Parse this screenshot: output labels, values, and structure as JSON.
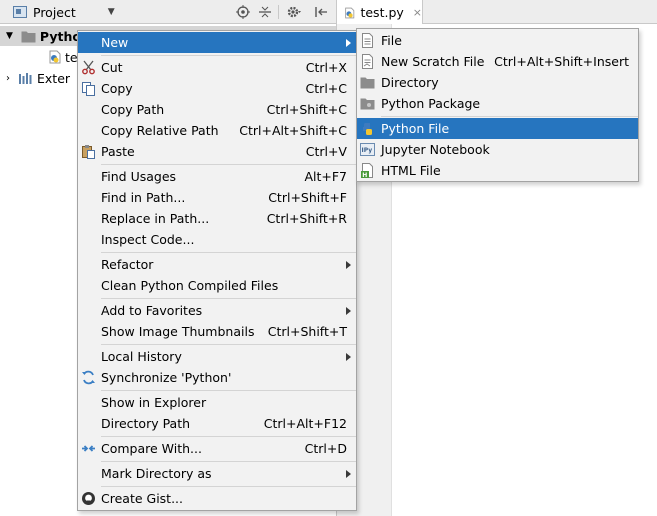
{
  "project_header": {
    "title": "Project"
  },
  "tree": {
    "root_label": "Pytho",
    "file_label": "te",
    "external_label": "Exter"
  },
  "editor": {
    "tab_label": "test.py"
  },
  "context_menu": {
    "items": [
      {
        "label": "New",
        "shortcut": "",
        "submenu": true,
        "icon": "none"
      },
      {
        "label": "Cut",
        "shortcut": "Ctrl+X",
        "icon": "scissors-icon"
      },
      {
        "label": "Copy",
        "shortcut": "Ctrl+C",
        "icon": "copy-icon"
      },
      {
        "label": "Copy Path",
        "shortcut": "Ctrl+Shift+C",
        "icon": "none"
      },
      {
        "label": "Copy Relative Path",
        "shortcut": "Ctrl+Alt+Shift+C",
        "icon": "none"
      },
      {
        "label": "Paste",
        "shortcut": "Ctrl+V",
        "icon": "paste-icon"
      },
      {
        "label": "Find Usages",
        "shortcut": "Alt+F7",
        "icon": "none"
      },
      {
        "label": "Find in Path...",
        "shortcut": "Ctrl+Shift+F",
        "icon": "none"
      },
      {
        "label": "Replace in Path...",
        "shortcut": "Ctrl+Shift+R",
        "icon": "none"
      },
      {
        "label": "Inspect Code...",
        "shortcut": "",
        "icon": "none"
      },
      {
        "label": "Refactor",
        "shortcut": "",
        "submenu": true,
        "icon": "none"
      },
      {
        "label": "Clean Python Compiled Files",
        "shortcut": "",
        "icon": "none"
      },
      {
        "label": "Add to Favorites",
        "shortcut": "",
        "submenu": true,
        "icon": "none"
      },
      {
        "label": "Show Image Thumbnails",
        "shortcut": "Ctrl+Shift+T",
        "icon": "none"
      },
      {
        "label": "Local History",
        "shortcut": "",
        "submenu": true,
        "icon": "none"
      },
      {
        "label": "Synchronize 'Python'",
        "shortcut": "",
        "icon": "sync-icon"
      },
      {
        "label": "Show in Explorer",
        "shortcut": "",
        "icon": "none"
      },
      {
        "label": "Directory Path",
        "shortcut": "Ctrl+Alt+F12",
        "icon": "none"
      },
      {
        "label": "Compare With...",
        "shortcut": "Ctrl+D",
        "icon": "compare-icon"
      },
      {
        "label": "Mark Directory as",
        "shortcut": "",
        "submenu": true,
        "icon": "none"
      },
      {
        "label": "Create Gist...",
        "shortcut": "",
        "icon": "github-icon"
      }
    ]
  },
  "new_submenu": {
    "items": [
      {
        "label": "File",
        "shortcut": "",
        "icon": "file-icon"
      },
      {
        "label": "New Scratch File",
        "shortcut": "Ctrl+Alt+Shift+Insert",
        "icon": "scratch-file-icon"
      },
      {
        "label": "Directory",
        "shortcut": "",
        "icon": "folder-icon"
      },
      {
        "label": "Python Package",
        "shortcut": "",
        "icon": "package-icon"
      },
      {
        "label": "Python File",
        "shortcut": "",
        "icon": "python-icon"
      },
      {
        "label": "Jupyter Notebook",
        "shortcut": "",
        "icon": "jupyter-icon"
      },
      {
        "label": "HTML File",
        "shortcut": "",
        "icon": "html-icon"
      }
    ]
  },
  "colors": {
    "selection": "#2675bf",
    "menu_bg": "#f2f2f2",
    "menu_border": "#a3a3a3"
  }
}
